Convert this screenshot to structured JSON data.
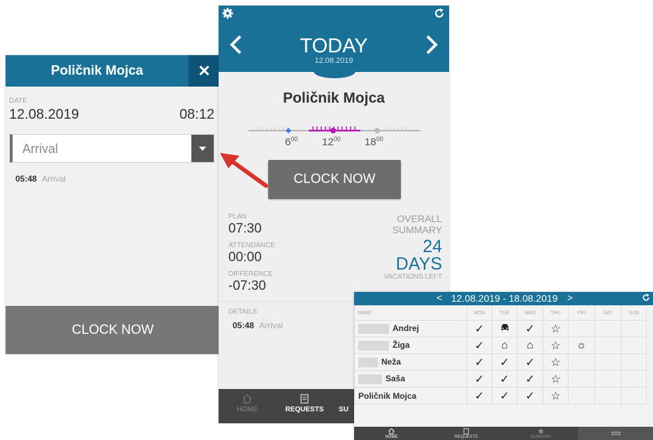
{
  "colors": {
    "accent": "#1a7198",
    "dark_accent": "#0e5478",
    "button": "#6d6d6d",
    "nav": "#444444",
    "arrow": "#d9342b",
    "timeline_pink": "#b51db5"
  },
  "left_panel": {
    "title": "Poličnik Mojca",
    "close_label": "✕",
    "date_label": "DATE",
    "date": "12.08.2019",
    "time": "08:12",
    "select_value": "Arrival",
    "entry_time": "05:48",
    "entry_label": "Arrival",
    "clock_label": "CLOCK NOW"
  },
  "mid_panel": {
    "icons": {
      "settings": "gear-icon",
      "refresh": "refresh-icon",
      "prev": "chevron-left-icon",
      "next": "chevron-right-icon"
    },
    "title": "TODAY",
    "date": "12.08.2019",
    "name": "Poličnik Mojca",
    "timeline_labels": [
      {
        "h": "6",
        "m": "00"
      },
      {
        "h": "12",
        "m": "00"
      },
      {
        "h": "18",
        "m": "00"
      }
    ],
    "clock_label": "CLOCK NOW",
    "plan_label": "PLAN",
    "plan": "07:30",
    "attendance_label": "ATTENDANCE",
    "attendance": "00:00",
    "difference_label": "DIFFERENCE",
    "difference": "-07:30",
    "overall": "OVERALL",
    "summary": "SUMMARY",
    "days_num": "24",
    "days": "DAYS",
    "vacations_left": "VACATIONS LEFT",
    "details_label": "DETAILS",
    "detail_time": "05:48",
    "detail_label": "Arrival",
    "nav": [
      {
        "label": "HOME"
      },
      {
        "label": "REQUESTS"
      },
      {
        "label": "SU"
      }
    ]
  },
  "week_panel": {
    "prev": "<",
    "range": "12.08.2019 - 18.08.2019",
    "next": ">",
    "headers": [
      "NAME",
      "MON",
      "TUE",
      "WED",
      "THU",
      "FRI",
      "SAT",
      "SUN"
    ],
    "rows": [
      {
        "name": "Andrej",
        "cells": [
          "✓",
          "🚗",
          "✓",
          "☆",
          "",
          "",
          ""
        ]
      },
      {
        "name": "Žiga",
        "cells": [
          "✓",
          "⌂",
          "⌂",
          "☆",
          "☼",
          "",
          ""
        ]
      },
      {
        "name": "Neža",
        "cells": [
          "✓",
          "✓",
          "✓",
          "☆",
          "",
          "",
          ""
        ]
      },
      {
        "name": "Saša",
        "cells": [
          "✓",
          "✓",
          "✓",
          "☆",
          "",
          "",
          ""
        ]
      },
      {
        "name": "Poličnik Mojca",
        "cells": [
          "✓",
          "✓",
          "✓",
          "☆",
          "",
          "",
          ""
        ]
      }
    ],
    "nav": [
      {
        "label": "HOME"
      },
      {
        "label": "REQUESTS"
      },
      {
        "label": "SUMMARY"
      }
    ]
  }
}
